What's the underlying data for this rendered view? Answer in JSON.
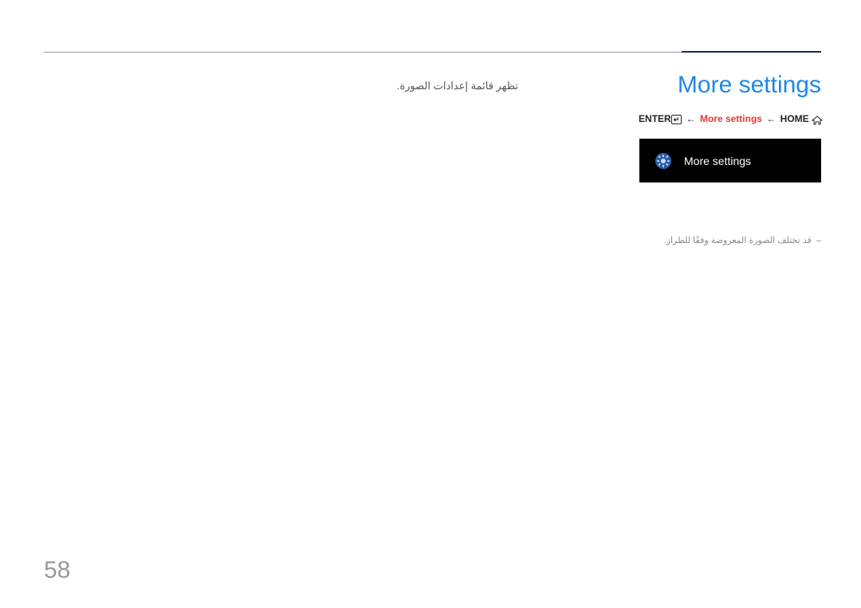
{
  "page": {
    "number": "58"
  },
  "section": {
    "title": "More settings"
  },
  "breadcrumb": {
    "enter_label": "ENTER",
    "arrow": "←",
    "highlight": "More settings",
    "home_label": "HOME"
  },
  "description": "تظهر قائمة إعدادات الصورة.",
  "menu": {
    "label": "More settings"
  },
  "note": {
    "dash": "–",
    "text": "قد تختلف الصورة المعروضة وفقًا للطراز."
  }
}
